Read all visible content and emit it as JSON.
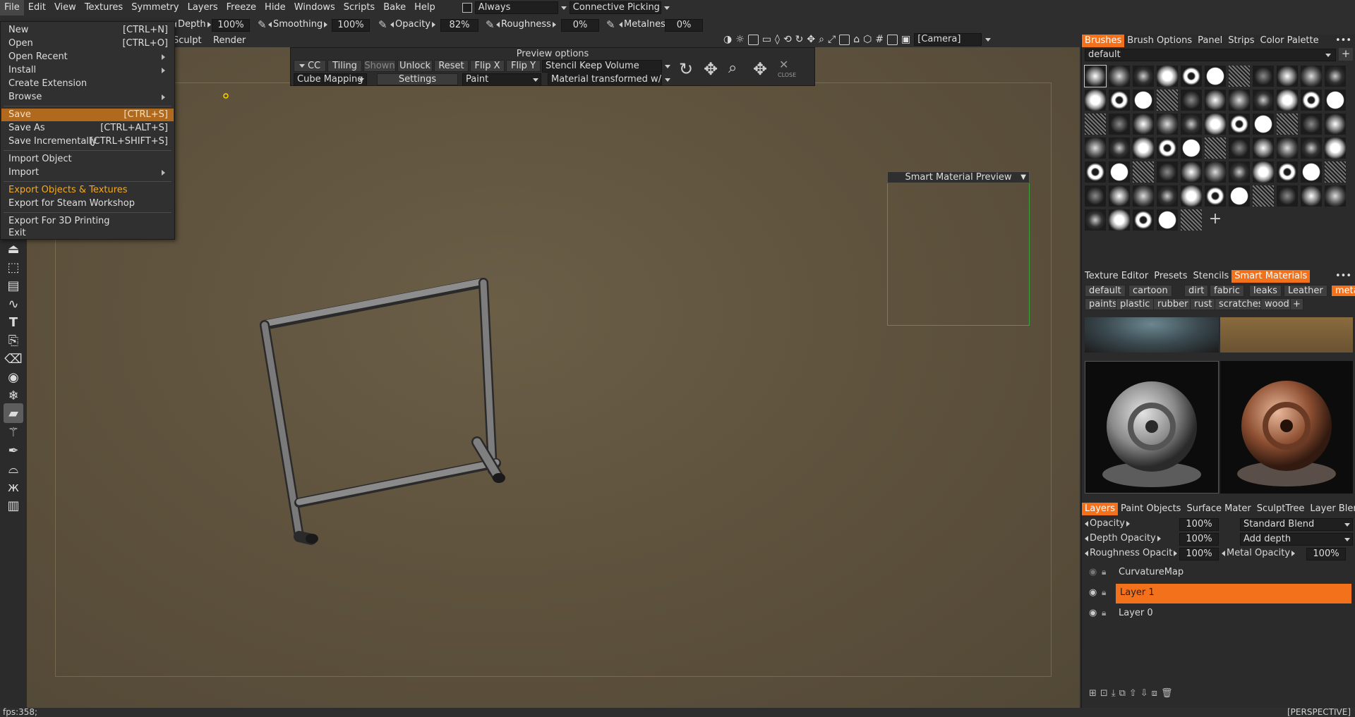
{
  "menubar": {
    "items": [
      "File",
      "Edit",
      "View",
      "Textures",
      "Symmetry",
      "Layers",
      "Freeze",
      "Hide",
      "Windows",
      "Scripts",
      "Bake",
      "Help"
    ],
    "always_label": "Always",
    "picking_label": "Connective Picking"
  },
  "toolbar": {
    "depth_label": "Depth",
    "depth_value": "100%",
    "smoothing_label": "Smoothing",
    "smoothing_value": "100%",
    "opacity_label": "Opacity",
    "opacity_value": "82%",
    "roughness_label": "Roughness",
    "roughness_value": "0%",
    "metalness_label": "Metalness",
    "metalness_value": "0%"
  },
  "rooms": {
    "sculpt": "Sculpt",
    "render": "Render"
  },
  "camera_label": "[Camera]",
  "file_menu": {
    "items": [
      {
        "label": "New",
        "shortcut": "[CTRL+N]"
      },
      {
        "label": "Open",
        "shortcut": "[CTRL+O]"
      },
      {
        "label": "Open  Recent",
        "shortcut": ""
      },
      {
        "label": "Install",
        "shortcut": ""
      },
      {
        "label": "Create  Extension",
        "shortcut": ""
      },
      {
        "label": "Browse",
        "shortcut": ""
      },
      {
        "label": "Save",
        "shortcut": "[CTRL+S]"
      },
      {
        "label": "Save  As",
        "shortcut": "[CTRL+ALT+S]"
      },
      {
        "label": "Save  Incrementally",
        "shortcut": "[CTRL+SHIFT+S]"
      },
      {
        "label": "Import  Object",
        "shortcut": ""
      },
      {
        "label": "Import",
        "shortcut": ""
      },
      {
        "label": "Export  Objects  &  Textures",
        "shortcut": ""
      },
      {
        "label": "Export  for  Steam  Workshop",
        "shortcut": ""
      },
      {
        "label": "Export  For  3D  Printing",
        "shortcut": ""
      },
      {
        "label": "Exit",
        "shortcut": ""
      }
    ]
  },
  "preview_options": {
    "title": "Preview  options",
    "cc": "CC",
    "tiling": "Tiling",
    "shown": "Shown",
    "unlock": "Unlock",
    "reset": "Reset",
    "flip_x": "Flip  X",
    "flip_y": "Flip  Y",
    "stencil_mode": "Stencil  Keep  Volume",
    "mapping": "Cube  Mapping",
    "settings": "Settings",
    "paint": "Paint",
    "material_mode": "Material  transformed  w/",
    "close": "CLOSE"
  },
  "smart_material_preview": {
    "title": "Smart  Material  Preview"
  },
  "brushes_panel": {
    "tabs": [
      "Brushes",
      "Brush  Options",
      "Panel",
      "Strips",
      "Color  Palette"
    ],
    "preset": "default"
  },
  "materials_panel": {
    "tabs": [
      "Texture  Editor",
      "Presets",
      "Stencils",
      "Smart  Materials"
    ],
    "categories_row1": [
      "default",
      "cartoon",
      "dirt",
      "fabric",
      "leaks",
      "Leather",
      "metals"
    ],
    "categories_row2": [
      "paints",
      "plastic",
      "rubber",
      "rust",
      "scratches",
      "wood"
    ]
  },
  "layers_panel": {
    "tabs": [
      "Layers",
      "Paint  Objects",
      "Surface  Mater",
      "SculptTree",
      "Layer  Blendin"
    ],
    "opacity_label": "Opacity",
    "opacity_value": "100%",
    "blend_mode": "Standard  Blend",
    "depth_opacity_label": "Depth  Opacity",
    "depth_opacity_value": "100%",
    "depth_mode": "Add  depth",
    "roughness_opacity_label": "Roughness  Opacit",
    "roughness_opacity_value": "100%",
    "metal_opacity_label": "Metal  Opacity",
    "metal_opacity_value": "100%",
    "layers": [
      "CurvatureMap",
      "Layer  1",
      "Layer  0"
    ]
  },
  "status": {
    "fps": "fps:358;",
    "view_mode": "[PERSPECTIVE]"
  },
  "colors": {
    "accent": "#f4711b",
    "menu_highlight": "#b16a1d",
    "export_text": "#f4a820"
  }
}
